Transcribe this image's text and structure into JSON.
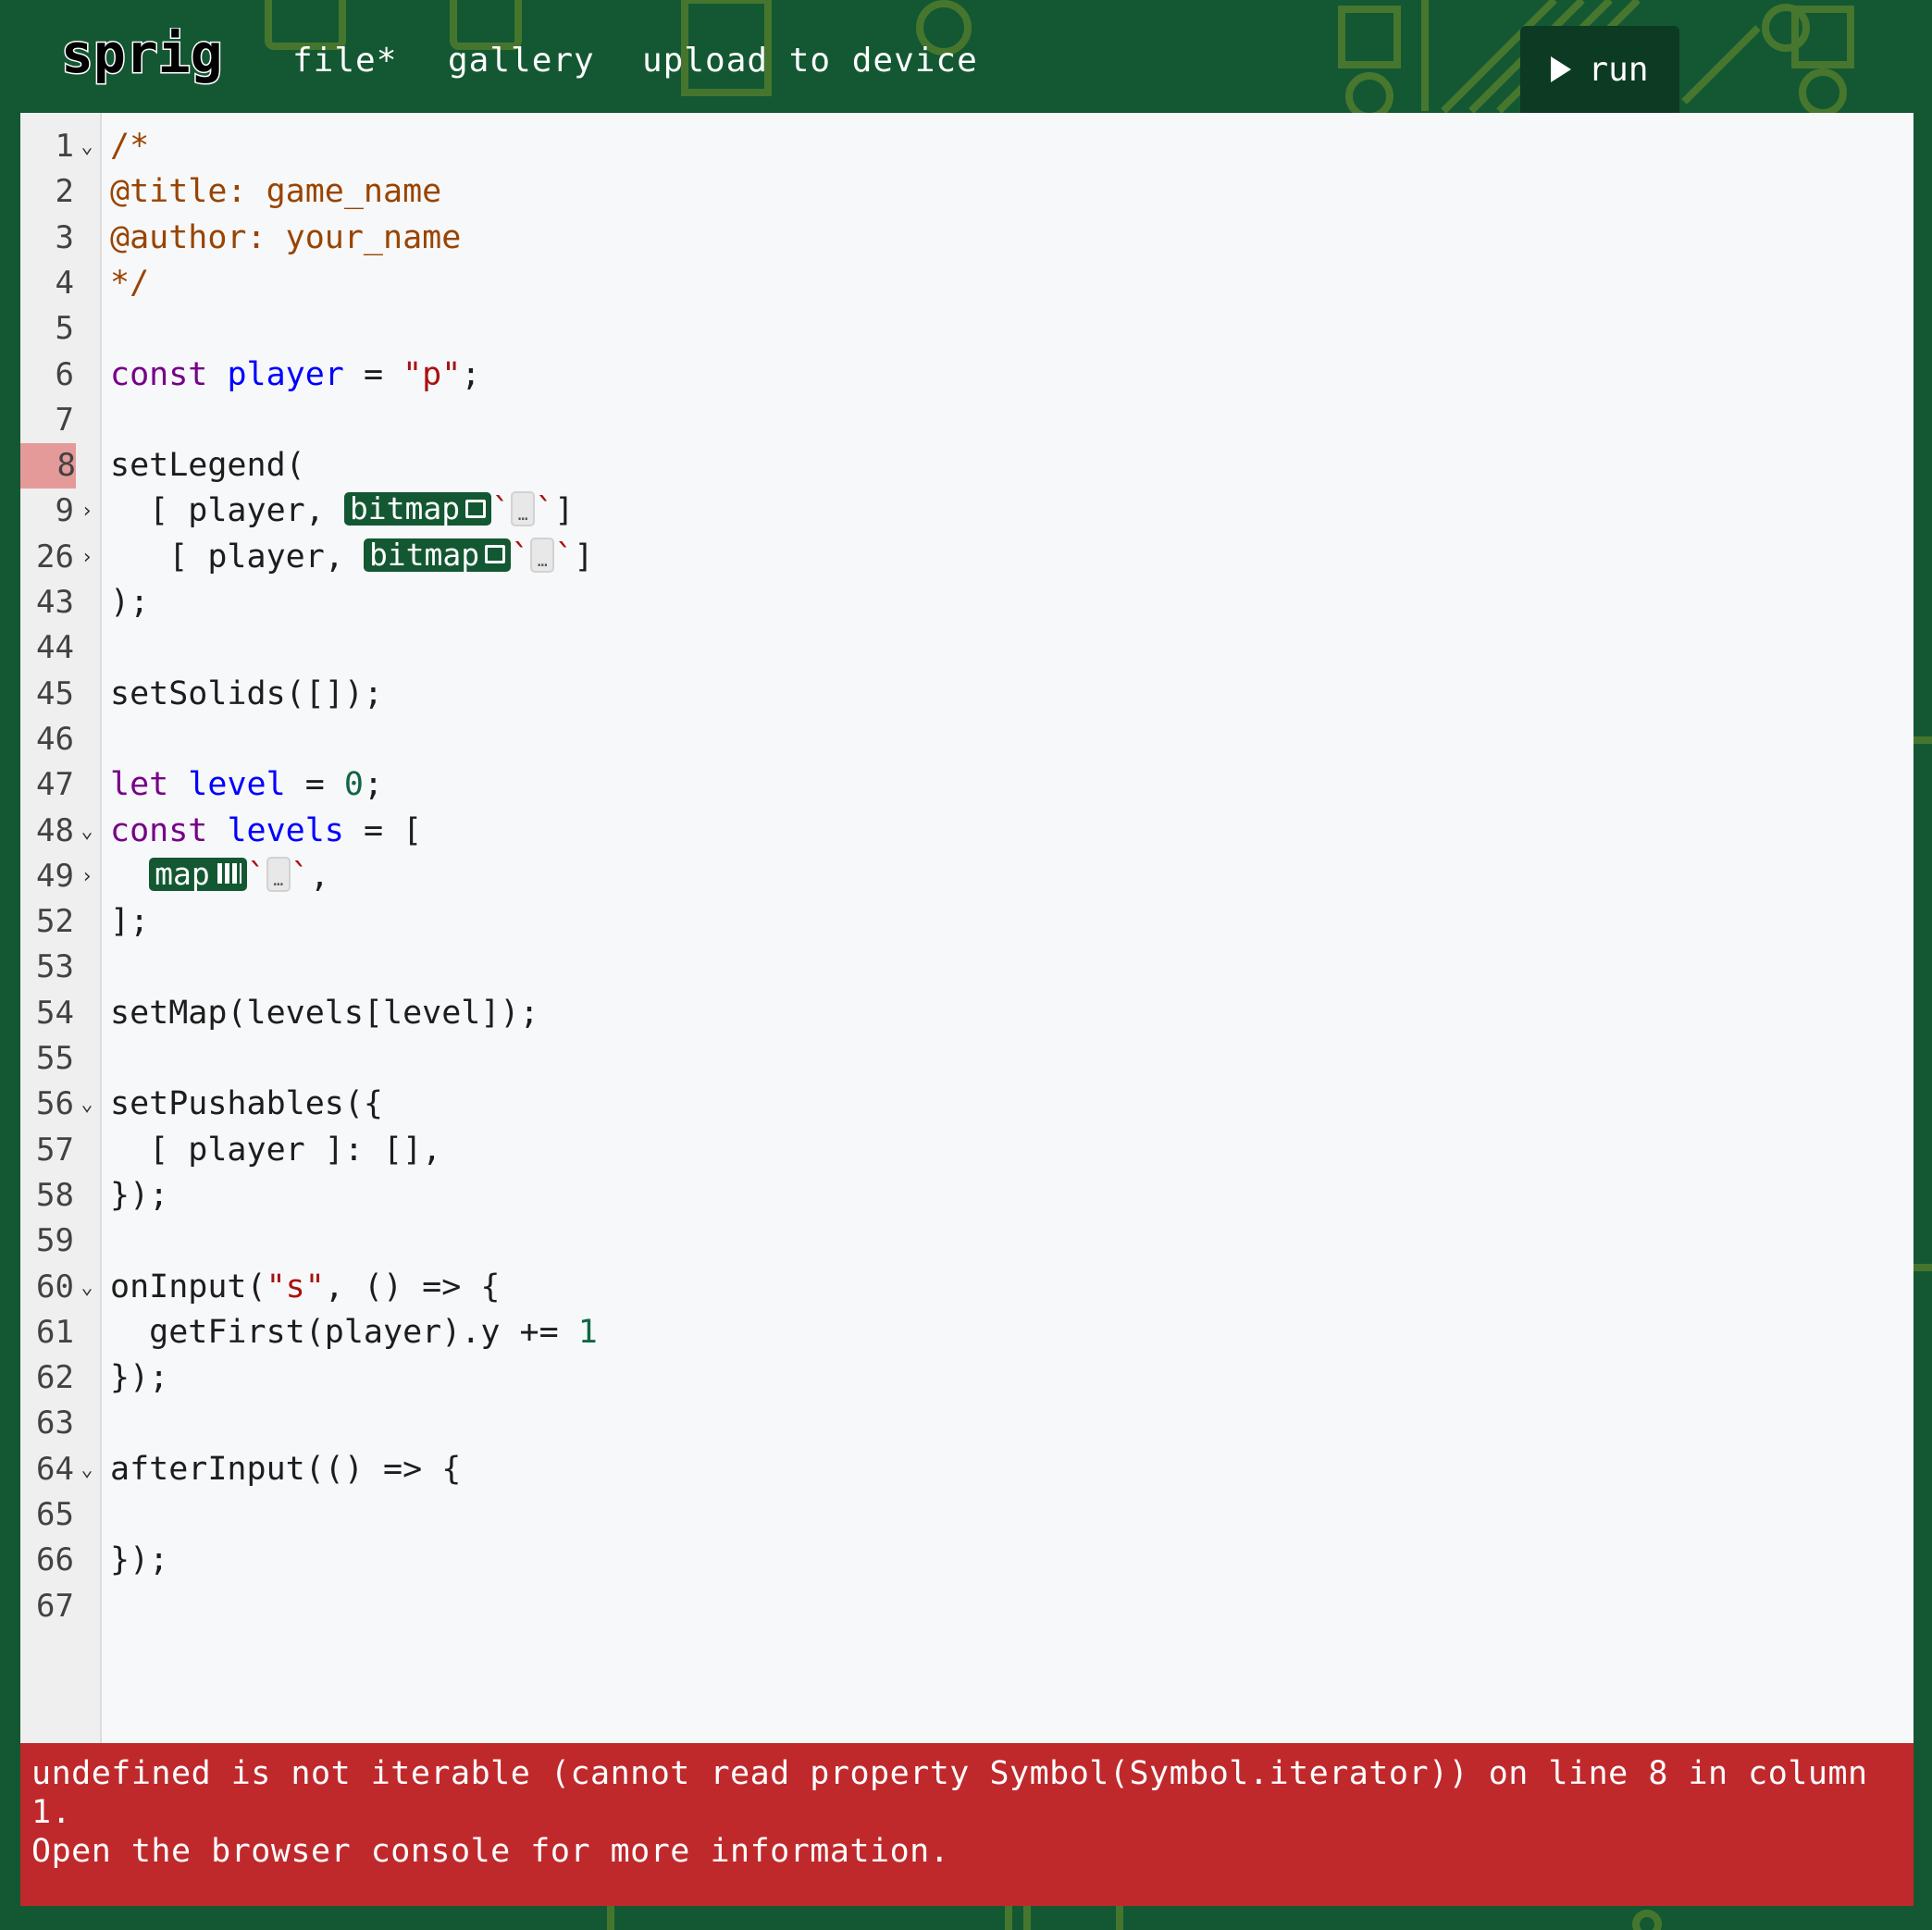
{
  "app": {
    "logo": "sprig"
  },
  "nav": {
    "file": "file*",
    "gallery": "gallery",
    "upload": "upload to device",
    "run": "run"
  },
  "editor": {
    "error_line": "8",
    "lines": [
      {
        "n": "1",
        "fold": "⌄",
        "segs": [
          {
            "t": "/*",
            "c": "cmt"
          }
        ]
      },
      {
        "n": "2",
        "segs": [
          {
            "t": "@title: game_name",
            "c": "cmt"
          }
        ]
      },
      {
        "n": "3",
        "segs": [
          {
            "t": "@author: your_name",
            "c": "cmt"
          }
        ]
      },
      {
        "n": "4",
        "segs": [
          {
            "t": "*/",
            "c": "cmt"
          }
        ]
      },
      {
        "n": "5",
        "segs": []
      },
      {
        "n": "6",
        "segs": [
          {
            "t": "const",
            "c": "kw"
          },
          {
            "t": " "
          },
          {
            "t": "player",
            "c": "def"
          },
          {
            "t": " = "
          },
          {
            "t": "\"p\"",
            "c": "str"
          },
          {
            "t": ";"
          }
        ]
      },
      {
        "n": "7",
        "segs": []
      },
      {
        "n": "8",
        "err": true,
        "segs": [
          {
            "t": "setLegend("
          }
        ]
      },
      {
        "n": "9",
        "fold": "›",
        "segs": [
          {
            "t": "  [ player, "
          },
          {
            "w": "bitmap"
          },
          {
            "t": "`",
            "c": "tick"
          },
          {
            "d": true
          },
          {
            "t": "`",
            "c": "tick"
          },
          {
            "t": "]"
          }
        ]
      },
      {
        "n": "26",
        "fold": "›",
        "segs": [
          {
            "t": "   [ player, "
          },
          {
            "w": "bitmap"
          },
          {
            "t": "`",
            "c": "tick"
          },
          {
            "d": true
          },
          {
            "t": "`",
            "c": "tick"
          },
          {
            "t": "]"
          }
        ]
      },
      {
        "n": "43",
        "segs": [
          {
            "t": ");"
          }
        ]
      },
      {
        "n": "44",
        "segs": []
      },
      {
        "n": "45",
        "segs": [
          {
            "t": "setSolids([]);"
          }
        ]
      },
      {
        "n": "46",
        "segs": []
      },
      {
        "n": "47",
        "segs": [
          {
            "t": "let",
            "c": "kw"
          },
          {
            "t": " "
          },
          {
            "t": "level",
            "c": "def"
          },
          {
            "t": " = "
          },
          {
            "t": "0",
            "c": "num"
          },
          {
            "t": ";"
          }
        ]
      },
      {
        "n": "48",
        "fold": "⌄",
        "segs": [
          {
            "t": "const",
            "c": "kw"
          },
          {
            "t": " "
          },
          {
            "t": "levels",
            "c": "def"
          },
          {
            "t": " = ["
          }
        ]
      },
      {
        "n": "49",
        "fold": "›",
        "segs": [
          {
            "t": "  "
          },
          {
            "w": "map"
          },
          {
            "t": "`",
            "c": "tick"
          },
          {
            "d": true
          },
          {
            "t": "`",
            "c": "tick"
          },
          {
            "t": ","
          }
        ]
      },
      {
        "n": "52",
        "segs": [
          {
            "t": "];"
          }
        ]
      },
      {
        "n": "53",
        "segs": []
      },
      {
        "n": "54",
        "segs": [
          {
            "t": "setMap(levels[level]);"
          }
        ]
      },
      {
        "n": "55",
        "segs": []
      },
      {
        "n": "56",
        "fold": "⌄",
        "segs": [
          {
            "t": "setPushables({"
          }
        ]
      },
      {
        "n": "57",
        "segs": [
          {
            "t": "  [ player ]: [],"
          }
        ]
      },
      {
        "n": "58",
        "segs": [
          {
            "t": "});"
          }
        ]
      },
      {
        "n": "59",
        "segs": []
      },
      {
        "n": "60",
        "fold": "⌄",
        "segs": [
          {
            "t": "onInput("
          },
          {
            "t": "\"s\"",
            "c": "str"
          },
          {
            "t": ", () => {"
          }
        ]
      },
      {
        "n": "61",
        "segs": [
          {
            "t": "  getFirst(player).y += "
          },
          {
            "t": "1",
            "c": "num"
          }
        ]
      },
      {
        "n": "62",
        "segs": [
          {
            "t": "});"
          }
        ]
      },
      {
        "n": "63",
        "segs": []
      },
      {
        "n": "64",
        "fold": "⌄",
        "segs": [
          {
            "t": "afterInput(() => {"
          }
        ]
      },
      {
        "n": "65",
        "segs": []
      },
      {
        "n": "66",
        "segs": [
          {
            "t": "});"
          }
        ]
      },
      {
        "n": "67",
        "segs": []
      }
    ]
  },
  "error": {
    "message": "undefined is not iterable (cannot read property Symbol(Symbol.iterator)) on line 8 in column 1.\nOpen the browser console for more information."
  },
  "colors": {
    "background": "#135832",
    "trace": "#6a7a2e",
    "error_bg": "#c0292c",
    "run_bg": "#0c3a22"
  }
}
